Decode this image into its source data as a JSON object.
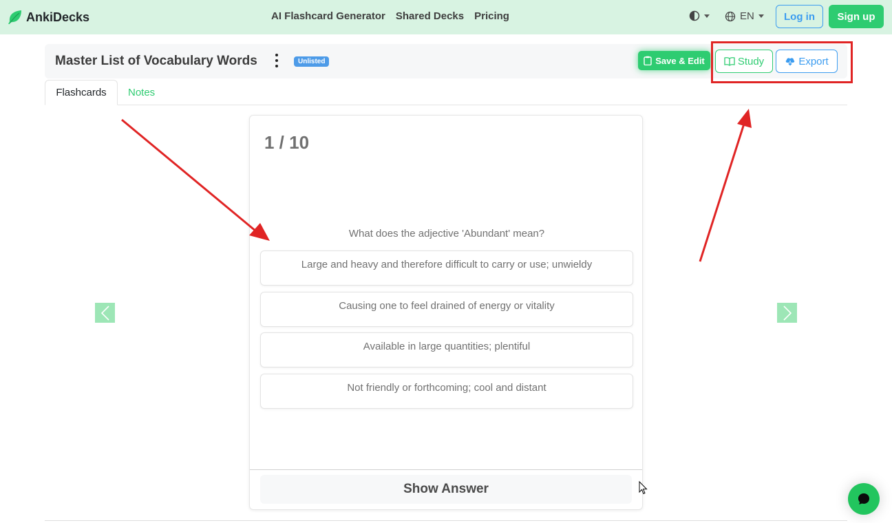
{
  "nav": {
    "brand": "AnkiDecks",
    "links": [
      "AI Flashcard Generator",
      "Shared Decks",
      "Pricing"
    ],
    "language": "EN",
    "login_label": "Log in",
    "signup_label": "Sign up"
  },
  "deck": {
    "title": "Master List of Vocabulary Words",
    "badge": "Unlisted",
    "save_edit_label": "Save & Edit",
    "study_label": "Study",
    "export_label": "Export"
  },
  "tabs": [
    {
      "label": "Flashcards",
      "active": true
    },
    {
      "label": "Notes",
      "active": false
    }
  ],
  "card": {
    "counter": "1 / 10",
    "question": "What does the adjective 'Abundant' mean?",
    "options": [
      "Large and heavy and therefore difficult to carry or use; unwieldy",
      "Causing one to feel drained of energy or vitality",
      "Available in large quantities; plentiful",
      "Not friendly or forthcoming; cool and distant"
    ],
    "show_answer_label": "Show Answer"
  },
  "colors": {
    "brand_green": "#2ecc71",
    "link_blue": "#3b9cf0",
    "annotation_red": "#e02424",
    "navbar_bg": "#d8f3e2"
  },
  "icons": [
    "leaf-icon",
    "contrast-icon",
    "globe-icon",
    "clipboard-icon",
    "book-icon",
    "cloud-download-icon",
    "chevron-left-icon",
    "chevron-right-icon",
    "chat-icon",
    "cursor-icon"
  ]
}
